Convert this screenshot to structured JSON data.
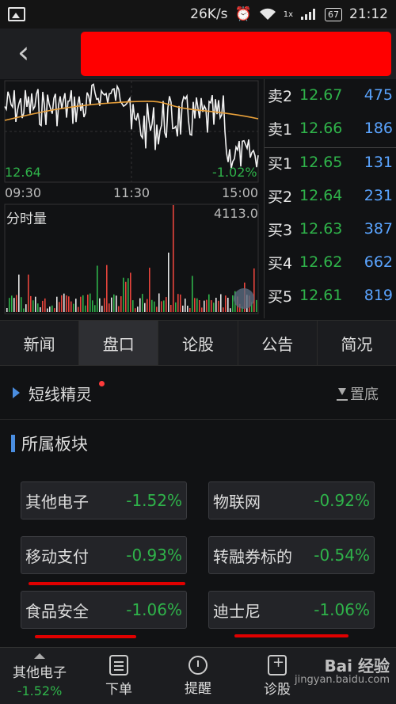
{
  "status_bar": {
    "speed": "26K/s",
    "battery": "67",
    "time": "21:12",
    "signal_label": "1x"
  },
  "header": {
    "back_glyph": "‹"
  },
  "chart": {
    "last_price": "12.64",
    "change_pct": "-1.02%",
    "time_start": "09:30",
    "time_mid": "11:30",
    "time_end": "15:00",
    "volume_label": "分时量",
    "volume_max": "4113.0"
  },
  "orderbook": [
    {
      "label": "卖2",
      "price": "12.67",
      "vol": "475"
    },
    {
      "label": "卖1",
      "price": "12.66",
      "vol": "186"
    },
    {
      "label": "买1",
      "price": "12.65",
      "vol": "131"
    },
    {
      "label": "买2",
      "price": "12.64",
      "vol": "231"
    },
    {
      "label": "买3",
      "price": "12.63",
      "vol": "387"
    },
    {
      "label": "买4",
      "price": "12.62",
      "vol": "662"
    },
    {
      "label": "买5",
      "price": "12.61",
      "vol": "819"
    }
  ],
  "tabs": [
    {
      "label": "新闻",
      "active": false
    },
    {
      "label": "盘口",
      "active": true
    },
    {
      "label": "论股",
      "active": false
    },
    {
      "label": "公告",
      "active": false
    },
    {
      "label": "简况",
      "active": false
    }
  ],
  "sprite": {
    "label": "短线精灵",
    "pin_label": "置底"
  },
  "sectors": {
    "title": "所属板块",
    "items": [
      {
        "name": "其他电子",
        "change": "-1.52%"
      },
      {
        "name": "物联网",
        "change": "-0.92%"
      },
      {
        "name": "移动支付",
        "change": "-0.93%"
      },
      {
        "name": "转融券标的",
        "change": "-0.54%"
      },
      {
        "name": "食品安全",
        "change": "-1.06%"
      },
      {
        "name": "迪士尼",
        "change": "-1.06%"
      }
    ]
  },
  "bottom_nav": {
    "stock_name": "其他电子",
    "stock_change": "-1.52%",
    "order_label": "下单",
    "alert_label": "提醒",
    "diagnose_label": "诊股"
  },
  "watermark": {
    "brand": "Bai 经验",
    "url": "jingyan.baidu.com"
  },
  "colors": {
    "up": "#e8453c",
    "down": "#2fb34a",
    "accent": "#4a8de0",
    "highlight_red": "#ff0000"
  }
}
